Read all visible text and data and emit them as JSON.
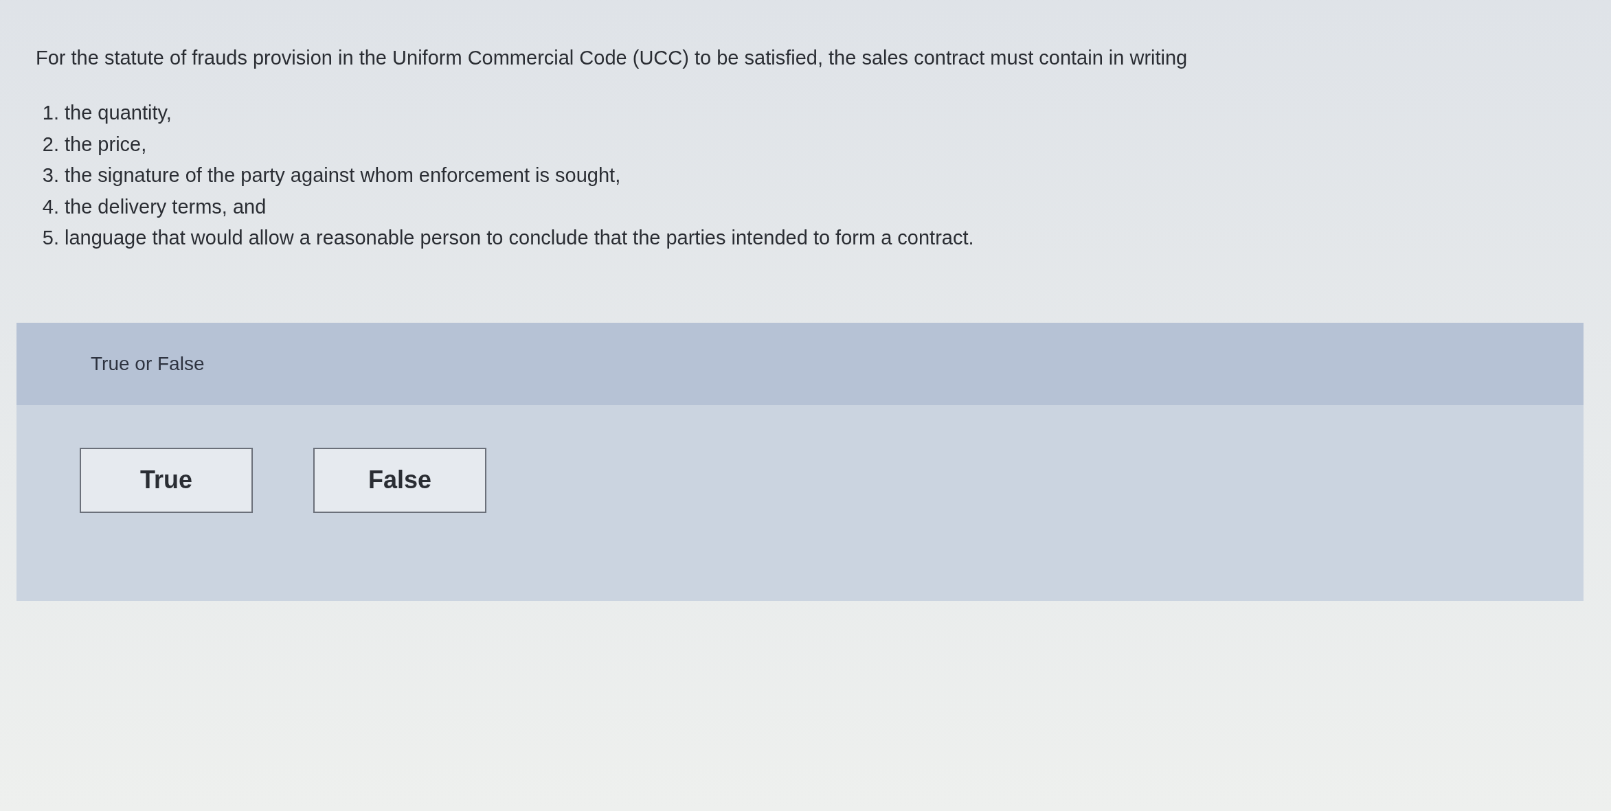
{
  "question": "For the statute of frauds provision in the Uniform Commercial Code (UCC) to be satisfied, the sales contract must contain in writing",
  "items": [
    {
      "number": "1.",
      "text": "the quantity,"
    },
    {
      "number": "2.",
      "text": "the price,"
    },
    {
      "number": "3.",
      "text": "the signature of the party against whom enforcement is sought,"
    },
    {
      "number": "4.",
      "text": "the delivery terms, and"
    },
    {
      "number": "5.",
      "text": "language that would allow a reasonable person to conclude that the parties intended to form a contract."
    }
  ],
  "answer_panel": {
    "title": "True or False",
    "options": [
      {
        "label": "True",
        "selected": false
      },
      {
        "label": "False",
        "selected": false
      }
    ]
  }
}
